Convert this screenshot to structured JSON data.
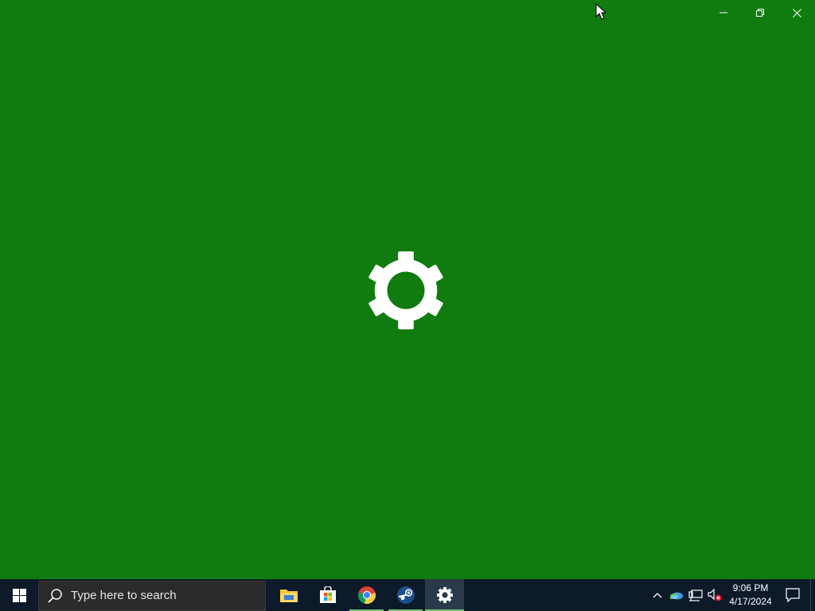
{
  "window": {
    "app_icon": "gear-icon",
    "background_color": "#107c10",
    "caption": {
      "minimize_icon": "minimize-icon",
      "restore_icon": "restore-icon",
      "close_icon": "close-icon"
    }
  },
  "taskbar": {
    "start_icon": "windows-logo-icon",
    "search": {
      "placeholder": "Type here to search",
      "icon": "search-icon"
    },
    "apps": [
      {
        "name": "File Explorer",
        "icon": "folder-icon",
        "running": false,
        "active": false
      },
      {
        "name": "Microsoft Store",
        "icon": "store-icon",
        "running": false,
        "active": false
      },
      {
        "name": "Google Chrome",
        "icon": "chrome-icon",
        "running": true,
        "active": false
      },
      {
        "name": "Steam",
        "icon": "steam-icon",
        "running": true,
        "active": false
      },
      {
        "name": "Settings",
        "icon": "gear-icon",
        "running": true,
        "active": true
      }
    ],
    "tray": {
      "icons": [
        "chevron-up-icon",
        "onedrive-icon",
        "network-icon",
        "volume-muted-icon"
      ],
      "time": "9:06 PM",
      "date": "4/17/2024",
      "notification_icon": "action-center-icon"
    }
  }
}
